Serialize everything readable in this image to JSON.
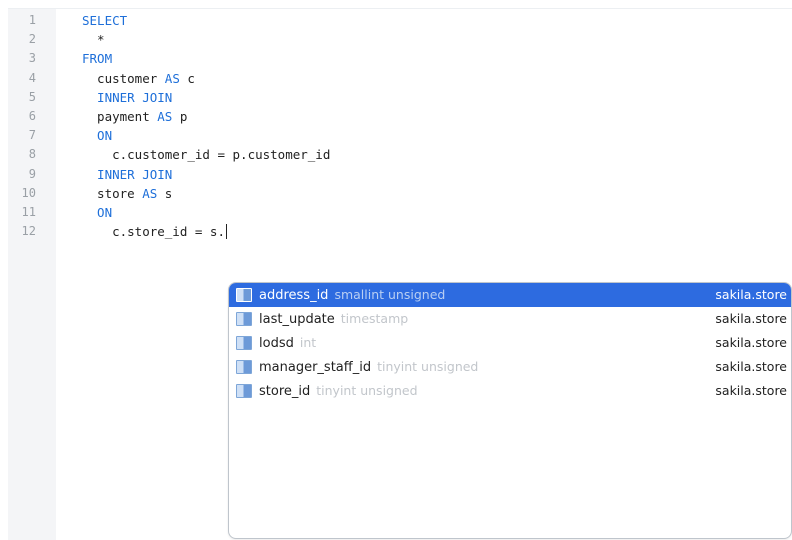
{
  "editor": {
    "lines": [
      {
        "num": "1",
        "parts": [
          {
            "t": "SELECT",
            "kw": true
          }
        ]
      },
      {
        "num": "2",
        "parts": [
          {
            "t": "  *",
            "kw": false
          }
        ]
      },
      {
        "num": "3",
        "parts": [
          {
            "t": "FROM",
            "kw": true
          }
        ]
      },
      {
        "num": "4",
        "parts": [
          {
            "t": "  customer ",
            "kw": false
          },
          {
            "t": "AS",
            "kw": true
          },
          {
            "t": " c",
            "kw": false
          }
        ]
      },
      {
        "num": "5",
        "parts": [
          {
            "t": "  INNER JOIN",
            "kw": true
          }
        ]
      },
      {
        "num": "6",
        "parts": [
          {
            "t": "  payment ",
            "kw": false
          },
          {
            "t": "AS",
            "kw": true
          },
          {
            "t": " p",
            "kw": false
          }
        ]
      },
      {
        "num": "7",
        "parts": [
          {
            "t": "  ON",
            "kw": true
          }
        ]
      },
      {
        "num": "8",
        "parts": [
          {
            "t": "    c.customer_id = p.customer_id",
            "kw": false
          }
        ]
      },
      {
        "num": "9",
        "parts": [
          {
            "t": "  INNER JOIN",
            "kw": true
          }
        ]
      },
      {
        "num": "10",
        "parts": [
          {
            "t": "  store ",
            "kw": false
          },
          {
            "t": "AS",
            "kw": true
          },
          {
            "t": " s",
            "kw": false
          }
        ]
      },
      {
        "num": "11",
        "parts": [
          {
            "t": "  ON",
            "kw": true
          }
        ]
      },
      {
        "num": "12",
        "parts": [
          {
            "t": "    c.store_id = s.",
            "kw": false
          }
        ],
        "caret": true
      }
    ]
  },
  "autocomplete": {
    "items": [
      {
        "name": "address_id",
        "type": "smallint unsigned",
        "source": "sakila.store",
        "selected": true,
        "icon": "column-icon"
      },
      {
        "name": "last_update",
        "type": "timestamp",
        "source": "sakila.store",
        "selected": false,
        "icon": "column-icon"
      },
      {
        "name": "lodsd",
        "type": "int",
        "source": "sakila.store",
        "selected": false,
        "icon": "column-icon"
      },
      {
        "name": "manager_staff_id",
        "type": "tinyint unsigned",
        "source": "sakila.store",
        "selected": false,
        "icon": "column-icon"
      },
      {
        "name": "store_id",
        "type": "tinyint unsigned",
        "source": "sakila.store",
        "selected": false,
        "icon": "column-icon"
      }
    ]
  },
  "colors": {
    "keyword": "#1e6fd9",
    "selection": "#2d6be0",
    "gutter_bg": "#f4f5f7",
    "line_number": "#9aa0a6",
    "type_hint": "#c2c6cb"
  }
}
